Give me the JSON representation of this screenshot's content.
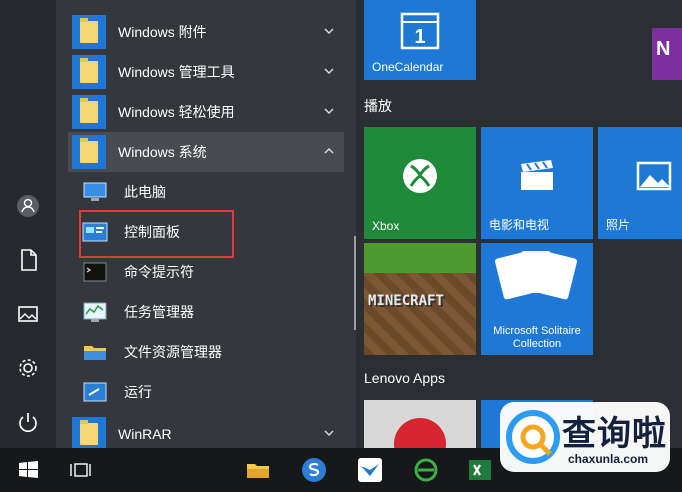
{
  "colors": {
    "accent": "#1e78d6",
    "tile_green": "#1f8a3a",
    "highlight_red": "#e03c3c",
    "folder_yellow": "#f4d675",
    "onenote_purple": "#7b2f9e"
  },
  "rail": {
    "icons": [
      "user-icon",
      "document-icon",
      "pictures-icon",
      "settings-icon",
      "power-icon"
    ]
  },
  "apps": {
    "folders": [
      {
        "label": "Windows 附件",
        "expanded": false
      },
      {
        "label": "Windows 管理工具",
        "expanded": false
      },
      {
        "label": "Windows 轻松使用",
        "expanded": false
      },
      {
        "label": "Windows 系统",
        "expanded": true
      }
    ],
    "system_items": [
      {
        "label": "此电脑",
        "icon": "computer-icon"
      },
      {
        "label": "控制面板",
        "icon": "control-panel-icon"
      },
      {
        "label": "命令提示符",
        "icon": "cmd-icon"
      },
      {
        "label": "任务管理器",
        "icon": "task-manager-icon"
      },
      {
        "label": "文件资源管理器",
        "icon": "file-explorer-icon"
      },
      {
        "label": "运行",
        "icon": "run-icon"
      }
    ],
    "bottom_folder": {
      "label": "WinRAR",
      "expanded": false
    }
  },
  "tiles": {
    "top_tile": {
      "label": "OneCalendar",
      "glyph": "1"
    },
    "groups": {
      "play": "播放",
      "lenovo": "Lenovo Apps"
    },
    "play_tiles": [
      {
        "label": "Xbox",
        "icon": "xbox-icon"
      },
      {
        "label": "电影和电视",
        "icon": "film-icon"
      },
      {
        "label": "照片",
        "icon": "photos-icon"
      }
    ],
    "minecraft": {
      "label": "MINECRAFT"
    },
    "solitaire": {
      "label": "Microsoft Solitaire Collection"
    }
  },
  "watermark": {
    "title": "查询啦",
    "site": "chaxunla.com"
  }
}
